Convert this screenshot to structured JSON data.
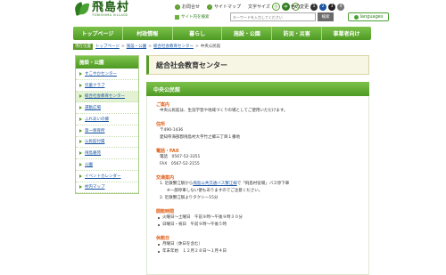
{
  "header": {
    "logo_name": "飛島村",
    "logo_sub": "TOBISHIMA VILLAGE",
    "guide": "お問合せ",
    "sitemap": "サイトマップ",
    "size_label": "文字サイズ",
    "size_options": [
      "小",
      "中",
      "大"
    ],
    "color_label": "色の変更",
    "color_options": [
      "1",
      "2",
      "3",
      "4"
    ],
    "search_label": "サイト内を検索",
    "search_placeholder": "キーワードを入力してください",
    "search_button": "検索",
    "language": "languages"
  },
  "gnav": {
    "items": [
      "トップページ",
      "村政情報",
      "暮らし",
      "施設・公園",
      "防災・災害",
      "事業者向け"
    ]
  },
  "breadcrumb": {
    "here": "現在位置",
    "items": [
      "トップページ",
      "施設・公園",
      "総合社会教育センター",
      "中央公民館"
    ]
  },
  "sidebar": {
    "title": "施設・公園",
    "items": [
      "すこやかセンター",
      "児童クラブ",
      "総合社会教育センター",
      "運動広場",
      "ふれあいの郷",
      "第一保育所",
      "公民館付属",
      "飛島墓苑",
      "公園",
      "イベントカレンダー",
      "村内マップ"
    ],
    "active_index": 2
  },
  "main": {
    "page_title": "総合社会教育センター",
    "section_title": "中央公民館",
    "sections": {
      "overview": {
        "heading": "ご案内",
        "text": "中央公民館は、生涯学習や地域づくりの場としてご使用いただけます。"
      },
      "address": {
        "heading": "住所",
        "postal": "〒490-1436",
        "line": "愛知県海部郡飛島村大字竹之郷三丁目１番地"
      },
      "phone": {
        "heading": "電話・FAX",
        "tel": "電話　0567-52-3351",
        "fax": "FAX　0567-52-2155"
      },
      "access": {
        "heading": "交通案内",
        "item1a": "1. 近鉄蟹江駅から",
        "item1_link": "飛島公共交通バス蟹江線",
        "item1b": "で「飛島村役場」バス停下車",
        "item1c": "※一部停車しない便もありますのでご注意ください。",
        "item2": "2. 近鉄蟹江駅よりタクシー15分"
      },
      "hours": {
        "heading": "開館時間",
        "items": [
          "火曜日～土曜日　午前９時～午後９時３０分",
          "日曜日・祝日　午前９時～午後５時"
        ]
      },
      "closed": {
        "heading": "休館日",
        "items": [
          "月曜日（休日を含む）",
          "年末年始　１２月２８日～１月４日"
        ]
      }
    }
  },
  "colors": {
    "brand_green": "#4e9a24",
    "heading_orange": "#e05a10",
    "link_blue": "#1a55a3"
  }
}
